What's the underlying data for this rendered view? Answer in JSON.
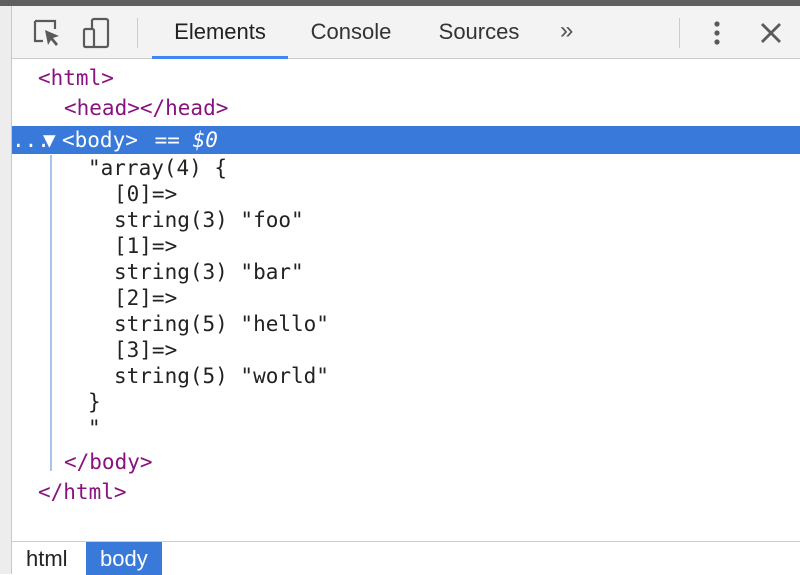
{
  "toolbar": {
    "inspect_icon": "inspect-element-icon",
    "device_icon": "device-toolbar-icon",
    "tabs": [
      {
        "label": "Elements",
        "active": true
      },
      {
        "label": "Console",
        "active": false
      },
      {
        "label": "Sources",
        "active": false
      }
    ],
    "more_tabs_label": "»",
    "menu_icon": "kebab-menu-icon",
    "close_icon": "close-icon"
  },
  "tree": {
    "html_open": "<html>",
    "head_line": "<head></head>",
    "body_row": {
      "ellipsis": "...",
      "arrow": "▼",
      "tag": "<body>",
      "ref": " == $0"
    },
    "text_lines": [
      "\"array(4) {",
      "[0]=>",
      "string(3) \"foo\"",
      "[1]=>",
      "string(3) \"bar\"",
      "[2]=>",
      "string(5) \"hello\"",
      "[3]=>",
      "string(5) \"world\"",
      "}",
      "\""
    ],
    "body_close": "</body>",
    "html_close": "</html>"
  },
  "breadcrumbs": [
    {
      "label": "html",
      "active": false
    },
    {
      "label": "body",
      "active": true
    }
  ],
  "colors": {
    "selection": "#3879d9",
    "tag": "#881280",
    "active_tab_underline": "#4285f4"
  }
}
